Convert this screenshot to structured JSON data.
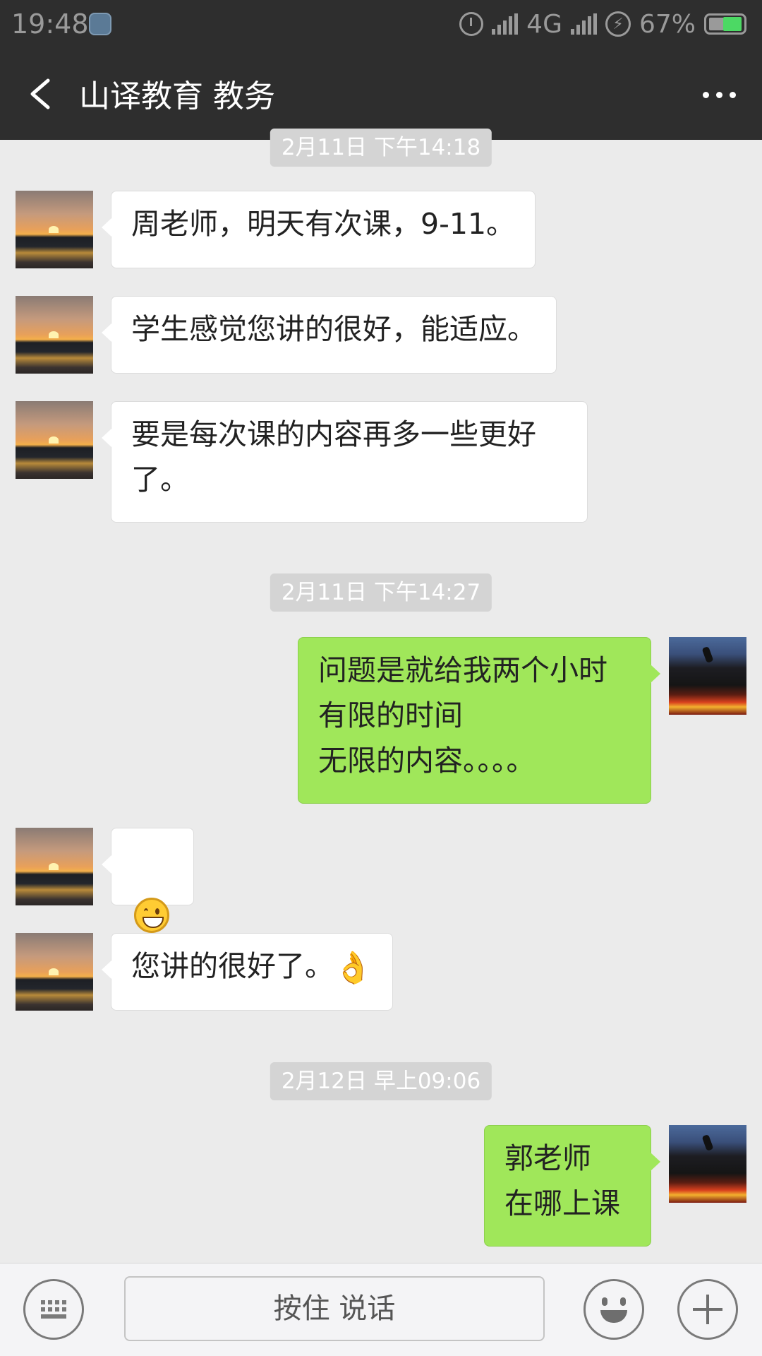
{
  "status_bar": {
    "time": "19:48",
    "network": "4G",
    "battery": "67%"
  },
  "header": {
    "title": "山译教育 教务"
  },
  "timestamps": [
    "2月11日 下午14:18",
    "2月11日 下午14:27",
    "2月12日 早上09:06"
  ],
  "messages": [
    {
      "side": "left",
      "text": "周老师，明天有次课，9-11。"
    },
    {
      "side": "left",
      "text": "学生感觉您讲的很好，能适应。"
    },
    {
      "side": "left",
      "text": "要是每次课的内容再多一些更好\n了。"
    },
    {
      "side": "right",
      "text": "问题是就给我两个小时\n有限的时间\n无限的内容。。。。"
    },
    {
      "side": "left",
      "emoji": "grinning-face"
    },
    {
      "side": "left",
      "text": "您讲的很好了。",
      "emoji": "ok-hand"
    },
    {
      "side": "right",
      "text": "郭老师\n在哪上课"
    }
  ],
  "input_bar": {
    "hold_to_talk": "按住 说话"
  },
  "colors": {
    "header_bg": "#2e2e2e",
    "chat_bg": "#ebebeb",
    "bubble_sent": "#a0e75a",
    "bubble_received": "#ffffff",
    "timestamp_bg": "#d4d4d4"
  }
}
